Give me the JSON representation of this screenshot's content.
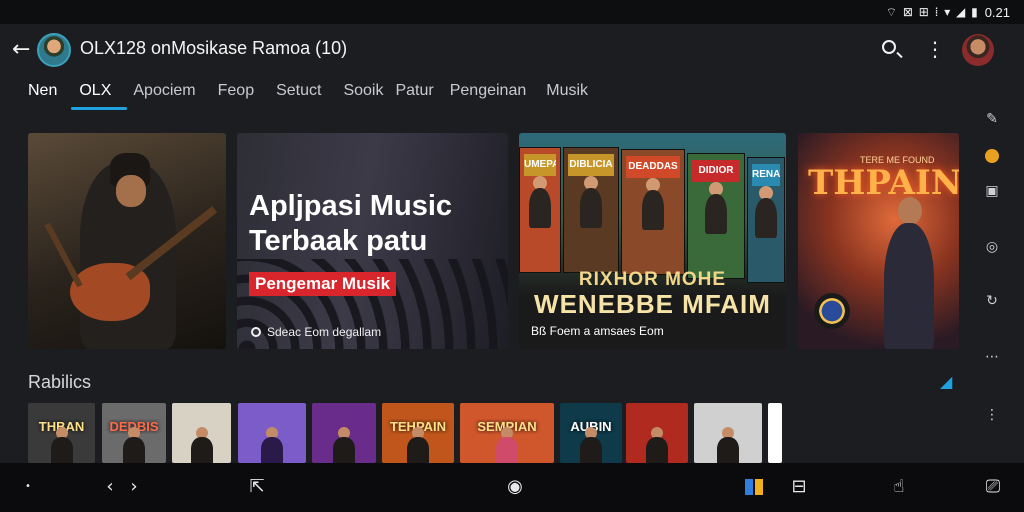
{
  "status_bar": {
    "icons": "⌔ ⊠ ⊞ ⁞ ▾ ◢ ▮",
    "time": "0.21"
  },
  "app_bar": {
    "title": "OLX128 onMosikase Ramoa",
    "title_badge": "(10)",
    "back_icon": "arrow-left-icon",
    "search_icon": "search-icon",
    "menu_icon": "more-vert-icon"
  },
  "tabs": [
    {
      "label": "Nen"
    },
    {
      "label": "OLX"
    },
    {
      "label": "Apociem"
    },
    {
      "label": "Feop"
    },
    {
      "label": "Setuct"
    },
    {
      "label": "Sooik"
    },
    {
      "label": "Patur"
    },
    {
      "label": "Pengeinan"
    },
    {
      "label": "Musik"
    }
  ],
  "featured": {
    "card2": {
      "heading_line1": "Apljpasi Music",
      "heading_line2": "Terbaak patu",
      "tag": "Pengemar Musik",
      "caption": "Sdeac Eom degallam"
    },
    "card3": {
      "banner_line1": "RIXHOR MOHE",
      "banner_line2": "WENEBBE MFAIM",
      "caption": "Bß Foem a amsaes Eom",
      "posters": [
        "UMEPAS",
        "DIBLICIA",
        "DEADDAS",
        "DIDIOR",
        "RENATO"
      ]
    },
    "card4": {
      "title": "THPAIN",
      "subtitle": "TERE ME FOUND"
    }
  },
  "side_rail": {
    "icons": [
      "edit-icon",
      "coin-icon",
      "image-icon",
      "compass-icon",
      "refresh-icon",
      "more-horiz-icon",
      "more-vert-icon"
    ]
  },
  "section": {
    "title": "Rabilics",
    "action_icon": "trending-icon",
    "thumbnails": [
      {
        "text": "THBAN",
        "bg": "#3a3a3a"
      },
      {
        "text": "DEDBIS",
        "bg": "#6b6b6b"
      },
      {
        "text": "",
        "bg": "#d8d2c4"
      },
      {
        "text": "",
        "bg": "#7c5cc8"
      },
      {
        "text": "",
        "bg": "#6a2c8a"
      },
      {
        "text": "TEHPAIN",
        "bg": "#c0561c"
      },
      {
        "text": "SEMPIAN",
        "bg": "#d0562c"
      },
      {
        "text": "AUBIN",
        "bg": "#0e3a4a"
      },
      {
        "text": "",
        "bg": "#b02a20"
      },
      {
        "text": "",
        "bg": "#d0d0d0"
      },
      {
        "text": "",
        "bg": "#ffffff"
      }
    ]
  },
  "nav_bar": {
    "icons": [
      "dot-icon",
      "prev-icon",
      "next-icon",
      "share-icon",
      "home-icon",
      "files-icon",
      "cart-icon",
      "hand-icon",
      "cast-icon"
    ]
  },
  "colors": {
    "accent": "#1fa2e0",
    "tag_red": "#d8262c",
    "background": "#1c1d21"
  }
}
